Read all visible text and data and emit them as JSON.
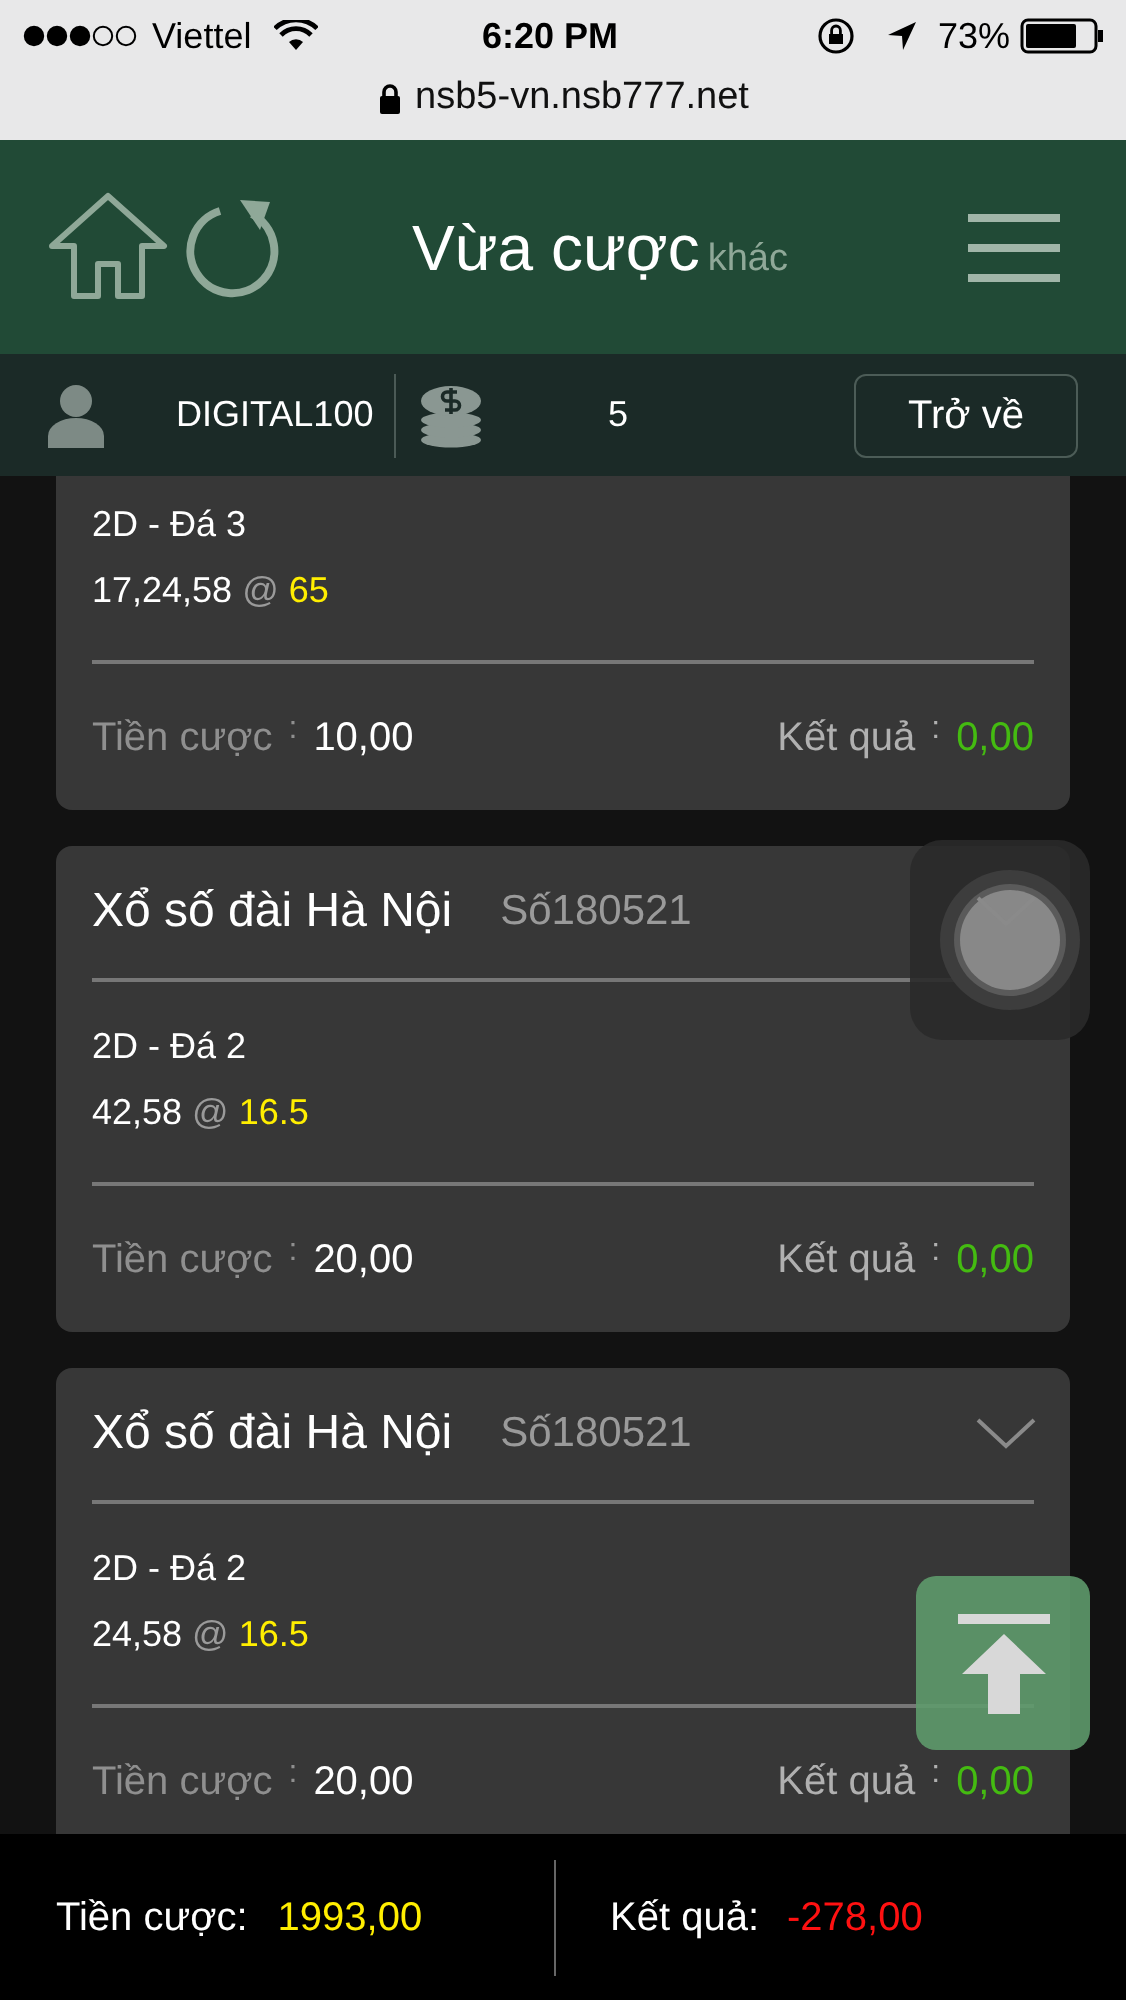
{
  "status_bar": {
    "carrier": "Viettel",
    "time": "6:20 PM",
    "battery": "73%"
  },
  "address_bar": {
    "url": "nsb5-vn.nsb777.net"
  },
  "header": {
    "title": "Vừa cược",
    "subtitle": "khác"
  },
  "user_bar": {
    "username": "DIGITAL100",
    "balance": "5",
    "back_button": "Trở về"
  },
  "bets": [
    {
      "bet_type": "2D - Đá 3",
      "numbers": "17,24,58",
      "at": "@",
      "odds": "65",
      "stake_label": "Tiền cược",
      "sep": ":",
      "stake": "10,00",
      "result_label": "Kết quả",
      "result": "0,00"
    },
    {
      "lottery": "Xổ số đài Hà Nội",
      "draw": "Số180521",
      "bet_type": "2D - Đá 2",
      "numbers": "42,58",
      "at": "@",
      "odds": "16.5",
      "stake_label": "Tiền cược",
      "sep": ":",
      "stake": "20,00",
      "result_label": "Kết quả",
      "result": "0,00"
    },
    {
      "lottery": "Xổ số đài Hà Nội",
      "draw": "Số180521",
      "bet_type": "2D - Đá 2",
      "numbers": "24,58",
      "at": "@",
      "odds": "16.5",
      "stake_label": "Tiền cược",
      "sep": ":",
      "stake": "20,00",
      "result_label": "Kết quả",
      "result": "0,00"
    }
  ],
  "totals": {
    "stake_label": "Tiền cược:",
    "stake": "1993,00",
    "result_label": "Kết quả:",
    "result": "-278,00"
  }
}
